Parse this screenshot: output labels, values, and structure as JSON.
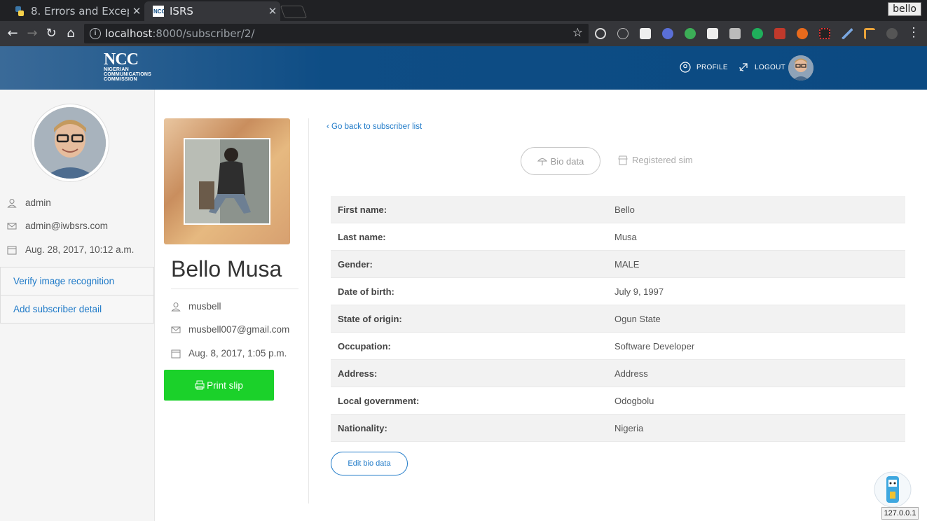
{
  "browser": {
    "tabs": [
      {
        "title": "8. Errors and Excep",
        "icon": "python-icon"
      },
      {
        "title": "ISRS",
        "icon": "ncc-favicon"
      }
    ],
    "profile_name": "bello",
    "url_host": "localhost",
    "url_rest": ":8000/subscriber/2/",
    "extensions": [
      "target-icon",
      "a-icon",
      "puzzle-icon",
      "r-icon",
      "d-icon",
      "dj-icon",
      "dj-icon",
      "evernote-icon",
      "printer-icon",
      "lifebuoy-icon",
      "color-icon",
      "pen-icon",
      "tool-icon",
      "leaf-icon"
    ]
  },
  "header": {
    "logo_big": "NCC",
    "logo_lines": [
      "NIGERIAN",
      "COMMUNICATIONS",
      "COMMISSION"
    ],
    "profile_label": "PROFILE",
    "logout_label": "LOGOUT"
  },
  "sidebar": {
    "username": "admin",
    "email": "admin@iwbsrs.com",
    "date": "Aug. 28, 2017, 10:12 a.m.",
    "links": [
      "Verify image recognition",
      "Add subscriber detail"
    ]
  },
  "subscriber": {
    "name": "Bello Musa",
    "username": "musbell",
    "email": "musbell007@gmail.com",
    "date": "Aug. 8, 2017, 1:05 p.m.",
    "print_label": "Print slip"
  },
  "main": {
    "back_label": "Go back to subscriber list",
    "tab_bio": "Bio data",
    "tab_sim": "Registered sim",
    "rows": [
      {
        "k": "First name:",
        "v": "Bello"
      },
      {
        "k": "Last name:",
        "v": "Musa"
      },
      {
        "k": "Gender:",
        "v": "MALE"
      },
      {
        "k": "Date of birth:",
        "v": "July 9, 1997"
      },
      {
        "k": "State of origin:",
        "v": "Ogun State"
      },
      {
        "k": "Occupation:",
        "v": "Software Developer"
      },
      {
        "k": "Address:",
        "v": "Address"
      },
      {
        "k": "Local government:",
        "v": "Odogbolu"
      },
      {
        "k": "Nationality:",
        "v": "Nigeria"
      }
    ],
    "edit_label": "Edit bio data"
  },
  "widget": {
    "ip": "127.0.0.1"
  },
  "colors": {
    "header": "#0b4a82",
    "link": "#1f7ac8",
    "print_button": "#1bd12a"
  }
}
